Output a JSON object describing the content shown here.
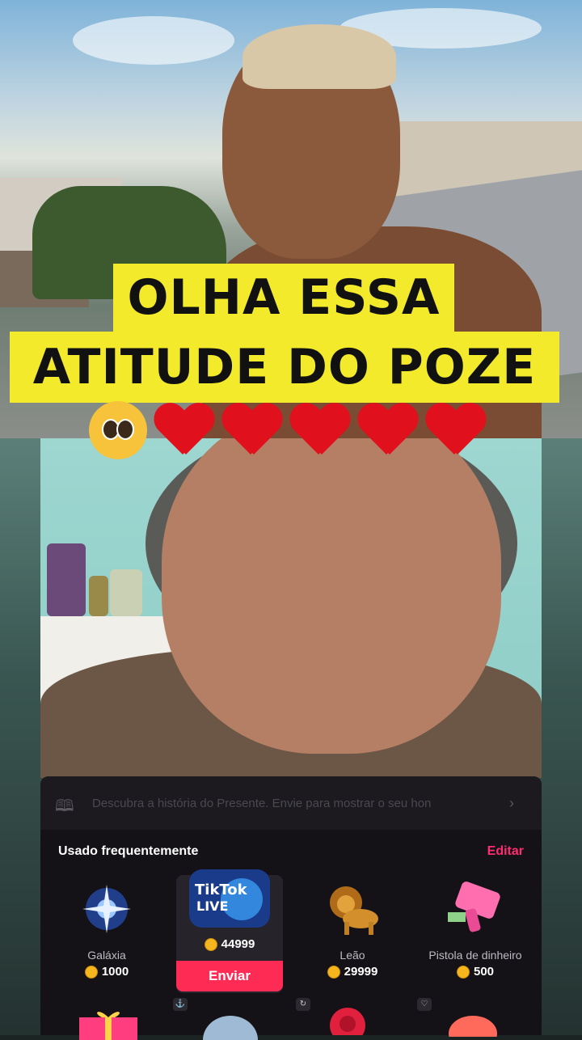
{
  "caption": {
    "line1": "OLHA ESSA",
    "line2": "ATITUDE DO POZE"
  },
  "emojis": [
    "pleading-face",
    "red-heart",
    "red-heart",
    "red-heart",
    "red-heart",
    "red-heart"
  ],
  "gift_panel": {
    "banner_text": "Descubra a história do Presente. Envie para mostrar o seu hon",
    "section_title": "Usado frequentemente",
    "edit_label": "Editar",
    "gifts": [
      {
        "name": "Galáxia",
        "price": "1000",
        "icon": "galaxy-gift-icon"
      },
      {
        "name": "",
        "price": "44999",
        "icon": "tiktok-live-gift-icon",
        "selected": true
      },
      {
        "name": "Leão",
        "price": "29999",
        "icon": "lion-gift-icon"
      },
      {
        "name": "Pistola de dinheiro",
        "price": "500",
        "icon": "money-gun-gift-icon"
      }
    ],
    "send_label": "Enviar",
    "accent_color": "#fe2c55"
  }
}
